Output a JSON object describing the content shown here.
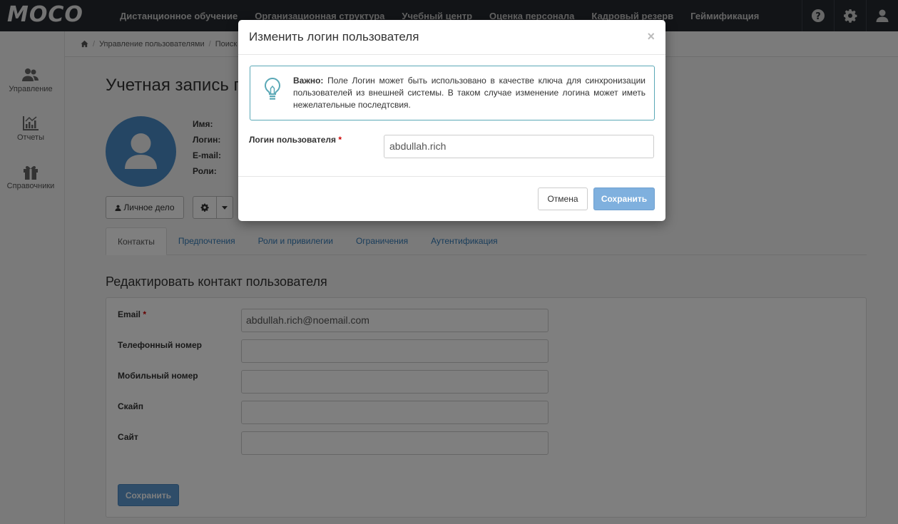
{
  "brand": {
    "logo_text": "MOCO"
  },
  "topnav": {
    "items": [
      "Дистанционное обучение",
      "Организационная структура",
      "Учебный центр",
      "Оценка персонала",
      "Кадровый резерв",
      "Геймификация"
    ],
    "icons": [
      "help-icon",
      "gear-icon",
      "user-icon"
    ]
  },
  "sidebar": {
    "items": [
      {
        "label": "Управление",
        "icon": "users-icon"
      },
      {
        "label": "Отчеты",
        "icon": "chart-icon"
      },
      {
        "label": "Справочники",
        "icon": "gift-icon"
      }
    ]
  },
  "breadcrumb": {
    "items": [
      "Управление пользователями",
      "Поиск"
    ]
  },
  "page": {
    "title": "Учетная запись п",
    "info_labels": [
      "Имя:",
      "Логин:",
      "E-mail:",
      "Роли:"
    ],
    "personal_file_button": "Личное дело"
  },
  "tabs": [
    "Контакты",
    "Предпочтения",
    "Роли и привилегии",
    "Ограничения",
    "Аутентификация"
  ],
  "contact_form": {
    "title": "Редактировать контакт пользователя",
    "fields": [
      {
        "label": "Email",
        "required": "*",
        "value": "abdullah.rich@noemail.com"
      },
      {
        "label": "Телефонный номер",
        "required": "",
        "value": ""
      },
      {
        "label": "Мобильный номер",
        "required": "",
        "value": ""
      },
      {
        "label": "Скайп",
        "required": "",
        "value": ""
      },
      {
        "label": "Сайт",
        "required": "",
        "value": ""
      }
    ],
    "save_button": "Сохранить"
  },
  "modal": {
    "title": "Изменить логин пользователя",
    "close": "×",
    "alert_strong": "Важно:",
    "alert_text": " Поле Логин может быть использовано в качестве ключа для синхронизации пользователей из внешней системы. В таком случае изменение логина может иметь нежелательные последтсвия.",
    "login_label": "Логин пользователя",
    "login_required": "*",
    "login_value": "abdullah.rich",
    "cancel_button": "Отмена",
    "save_button": "Сохранить"
  },
  "colors": {
    "topbar": "#24282e",
    "accent": "#337ab7",
    "primary_button": "#7fb0de",
    "alert_border": "#5aa8b6",
    "avatar": "#4a8cc9"
  }
}
